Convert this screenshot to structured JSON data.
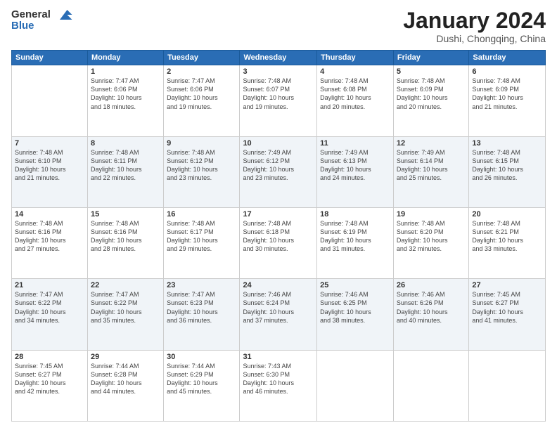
{
  "header": {
    "logo_line1": "General",
    "logo_line2": "Blue",
    "month": "January 2024",
    "location": "Dushi, Chongqing, China"
  },
  "weekdays": [
    "Sunday",
    "Monday",
    "Tuesday",
    "Wednesday",
    "Thursday",
    "Friday",
    "Saturday"
  ],
  "weeks": [
    [
      {
        "day": "",
        "sunrise": "",
        "sunset": "",
        "daylight": ""
      },
      {
        "day": "1",
        "sunrise": "Sunrise: 7:47 AM",
        "sunset": "Sunset: 6:06 PM",
        "daylight": "Daylight: 10 hours and 18 minutes."
      },
      {
        "day": "2",
        "sunrise": "Sunrise: 7:47 AM",
        "sunset": "Sunset: 6:06 PM",
        "daylight": "Daylight: 10 hours and 19 minutes."
      },
      {
        "day": "3",
        "sunrise": "Sunrise: 7:48 AM",
        "sunset": "Sunset: 6:07 PM",
        "daylight": "Daylight: 10 hours and 19 minutes."
      },
      {
        "day": "4",
        "sunrise": "Sunrise: 7:48 AM",
        "sunset": "Sunset: 6:08 PM",
        "daylight": "Daylight: 10 hours and 20 minutes."
      },
      {
        "day": "5",
        "sunrise": "Sunrise: 7:48 AM",
        "sunset": "Sunset: 6:09 PM",
        "daylight": "Daylight: 10 hours and 20 minutes."
      },
      {
        "day": "6",
        "sunrise": "Sunrise: 7:48 AM",
        "sunset": "Sunset: 6:09 PM",
        "daylight": "Daylight: 10 hours and 21 minutes."
      }
    ],
    [
      {
        "day": "7",
        "sunrise": "Sunrise: 7:48 AM",
        "sunset": "Sunset: 6:10 PM",
        "daylight": "Daylight: 10 hours and 21 minutes."
      },
      {
        "day": "8",
        "sunrise": "Sunrise: 7:48 AM",
        "sunset": "Sunset: 6:11 PM",
        "daylight": "Daylight: 10 hours and 22 minutes."
      },
      {
        "day": "9",
        "sunrise": "Sunrise: 7:48 AM",
        "sunset": "Sunset: 6:12 PM",
        "daylight": "Daylight: 10 hours and 23 minutes."
      },
      {
        "day": "10",
        "sunrise": "Sunrise: 7:49 AM",
        "sunset": "Sunset: 6:12 PM",
        "daylight": "Daylight: 10 hours and 23 minutes."
      },
      {
        "day": "11",
        "sunrise": "Sunrise: 7:49 AM",
        "sunset": "Sunset: 6:13 PM",
        "daylight": "Daylight: 10 hours and 24 minutes."
      },
      {
        "day": "12",
        "sunrise": "Sunrise: 7:49 AM",
        "sunset": "Sunset: 6:14 PM",
        "daylight": "Daylight: 10 hours and 25 minutes."
      },
      {
        "day": "13",
        "sunrise": "Sunrise: 7:48 AM",
        "sunset": "Sunset: 6:15 PM",
        "daylight": "Daylight: 10 hours and 26 minutes."
      }
    ],
    [
      {
        "day": "14",
        "sunrise": "Sunrise: 7:48 AM",
        "sunset": "Sunset: 6:16 PM",
        "daylight": "Daylight: 10 hours and 27 minutes."
      },
      {
        "day": "15",
        "sunrise": "Sunrise: 7:48 AM",
        "sunset": "Sunset: 6:16 PM",
        "daylight": "Daylight: 10 hours and 28 minutes."
      },
      {
        "day": "16",
        "sunrise": "Sunrise: 7:48 AM",
        "sunset": "Sunset: 6:17 PM",
        "daylight": "Daylight: 10 hours and 29 minutes."
      },
      {
        "day": "17",
        "sunrise": "Sunrise: 7:48 AM",
        "sunset": "Sunset: 6:18 PM",
        "daylight": "Daylight: 10 hours and 30 minutes."
      },
      {
        "day": "18",
        "sunrise": "Sunrise: 7:48 AM",
        "sunset": "Sunset: 6:19 PM",
        "daylight": "Daylight: 10 hours and 31 minutes."
      },
      {
        "day": "19",
        "sunrise": "Sunrise: 7:48 AM",
        "sunset": "Sunset: 6:20 PM",
        "daylight": "Daylight: 10 hours and 32 minutes."
      },
      {
        "day": "20",
        "sunrise": "Sunrise: 7:48 AM",
        "sunset": "Sunset: 6:21 PM",
        "daylight": "Daylight: 10 hours and 33 minutes."
      }
    ],
    [
      {
        "day": "21",
        "sunrise": "Sunrise: 7:47 AM",
        "sunset": "Sunset: 6:22 PM",
        "daylight": "Daylight: 10 hours and 34 minutes."
      },
      {
        "day": "22",
        "sunrise": "Sunrise: 7:47 AM",
        "sunset": "Sunset: 6:22 PM",
        "daylight": "Daylight: 10 hours and 35 minutes."
      },
      {
        "day": "23",
        "sunrise": "Sunrise: 7:47 AM",
        "sunset": "Sunset: 6:23 PM",
        "daylight": "Daylight: 10 hours and 36 minutes."
      },
      {
        "day": "24",
        "sunrise": "Sunrise: 7:46 AM",
        "sunset": "Sunset: 6:24 PM",
        "daylight": "Daylight: 10 hours and 37 minutes."
      },
      {
        "day": "25",
        "sunrise": "Sunrise: 7:46 AM",
        "sunset": "Sunset: 6:25 PM",
        "daylight": "Daylight: 10 hours and 38 minutes."
      },
      {
        "day": "26",
        "sunrise": "Sunrise: 7:46 AM",
        "sunset": "Sunset: 6:26 PM",
        "daylight": "Daylight: 10 hours and 40 minutes."
      },
      {
        "day": "27",
        "sunrise": "Sunrise: 7:45 AM",
        "sunset": "Sunset: 6:27 PM",
        "daylight": "Daylight: 10 hours and 41 minutes."
      }
    ],
    [
      {
        "day": "28",
        "sunrise": "Sunrise: 7:45 AM",
        "sunset": "Sunset: 6:27 PM",
        "daylight": "Daylight: 10 hours and 42 minutes."
      },
      {
        "day": "29",
        "sunrise": "Sunrise: 7:44 AM",
        "sunset": "Sunset: 6:28 PM",
        "daylight": "Daylight: 10 hours and 44 minutes."
      },
      {
        "day": "30",
        "sunrise": "Sunrise: 7:44 AM",
        "sunset": "Sunset: 6:29 PM",
        "daylight": "Daylight: 10 hours and 45 minutes."
      },
      {
        "day": "31",
        "sunrise": "Sunrise: 7:43 AM",
        "sunset": "Sunset: 6:30 PM",
        "daylight": "Daylight: 10 hours and 46 minutes."
      },
      {
        "day": "",
        "sunrise": "",
        "sunset": "",
        "daylight": ""
      },
      {
        "day": "",
        "sunrise": "",
        "sunset": "",
        "daylight": ""
      },
      {
        "day": "",
        "sunrise": "",
        "sunset": "",
        "daylight": ""
      }
    ]
  ]
}
